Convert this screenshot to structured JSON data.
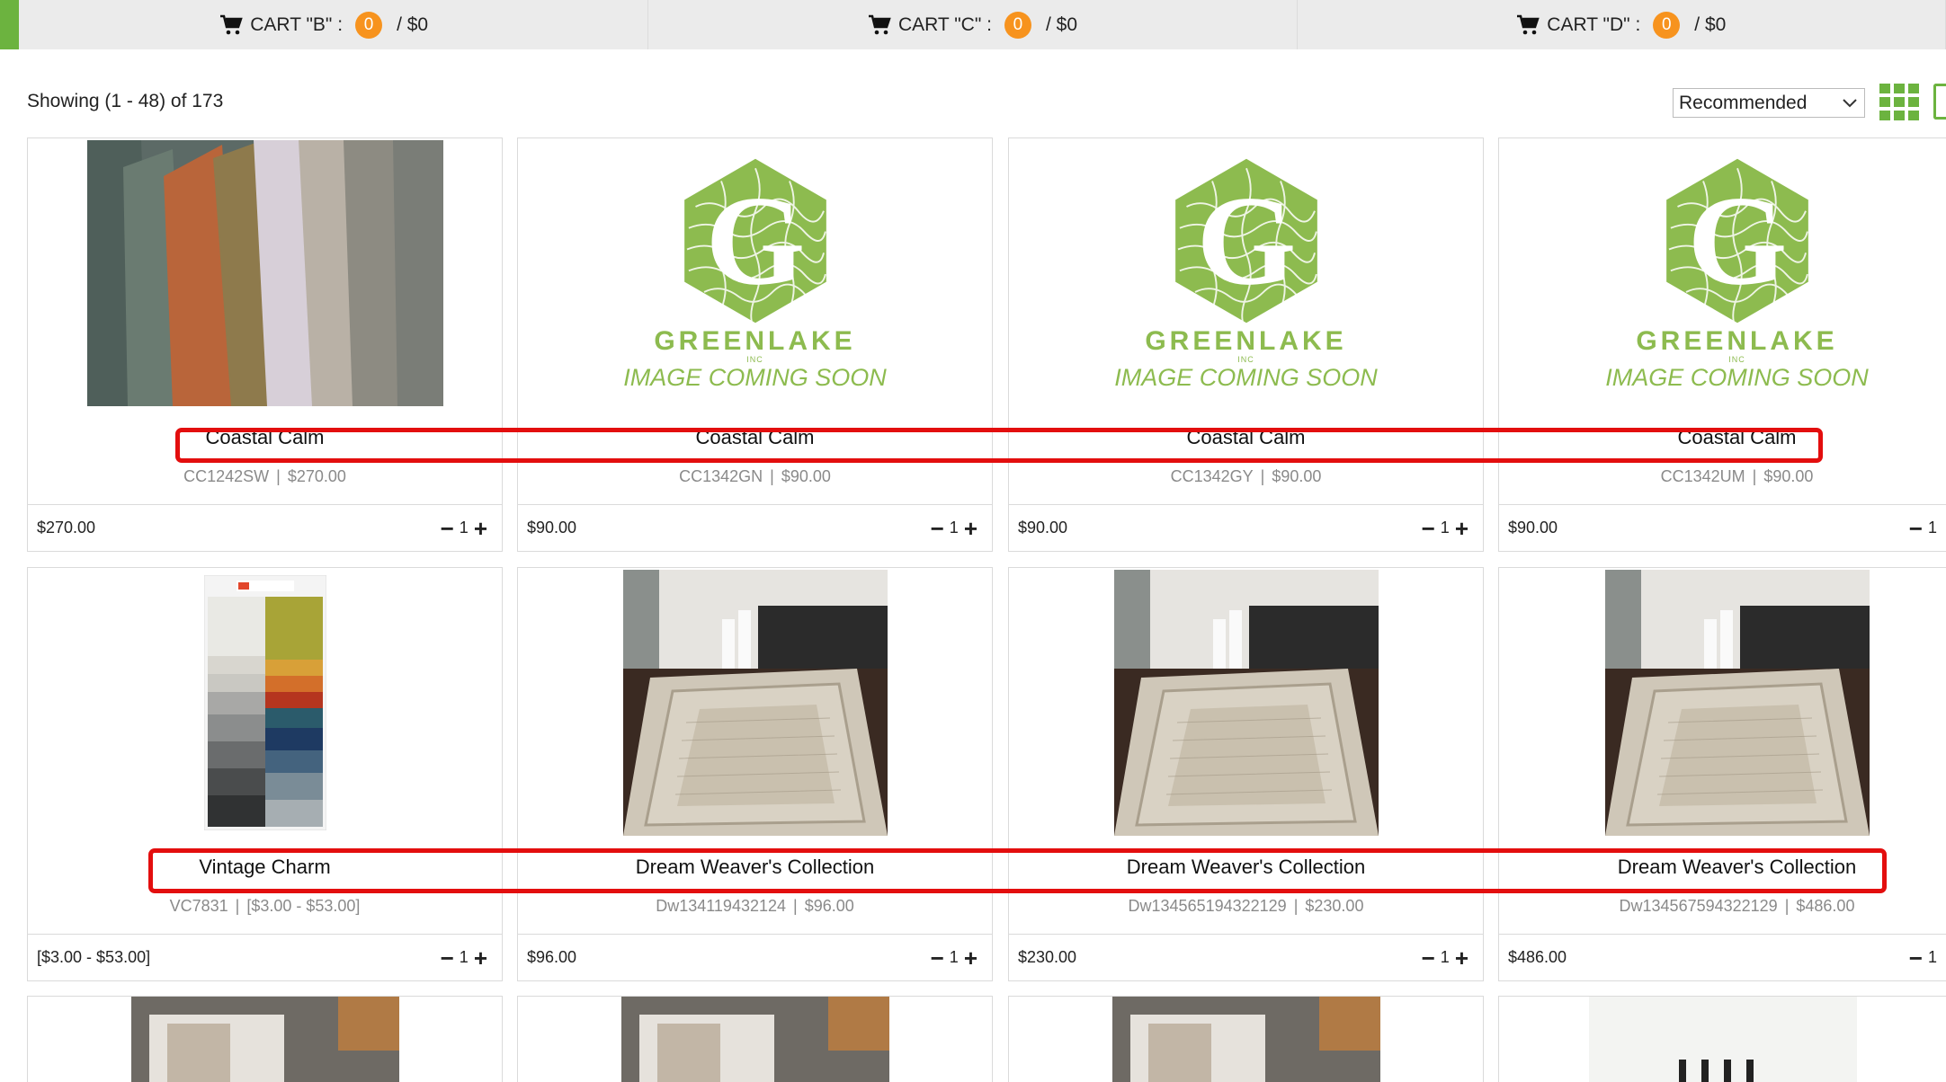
{
  "carts": [
    {
      "label": "CART \"B\" :",
      "count": "0",
      "total": "/ $0"
    },
    {
      "label": "CART \"C\" :",
      "count": "0",
      "total": "/ $0"
    },
    {
      "label": "CART \"D\" :",
      "count": "0",
      "total": "/ $0"
    }
  ],
  "toolbar": {
    "showing": "Showing (1 - 48) of 173",
    "sort_selected": "Recommended"
  },
  "colors": {
    "accent": "#6cb33f",
    "badge": "#f7931e",
    "highlight": "#e30e0e",
    "logo_green": "#8dbb4f"
  },
  "logo": {
    "brand": "GREENLAKE",
    "inc": "INC",
    "placeholder": "IMAGE COMING SOON"
  },
  "products": [
    {
      "name": "Coastal Calm",
      "sku": "CC1242SW",
      "sku_price": "$270.00",
      "price": "$270.00",
      "qty": "1",
      "image": "fabric-swatches"
    },
    {
      "name": "Coastal Calm",
      "sku": "CC1342GN",
      "sku_price": "$90.00",
      "price": "$90.00",
      "qty": "1",
      "image": "greenlake-placeholder"
    },
    {
      "name": "Coastal Calm",
      "sku": "CC1342GY",
      "sku_price": "$90.00",
      "price": "$90.00",
      "qty": "1",
      "image": "greenlake-placeholder"
    },
    {
      "name": "Coastal Calm",
      "sku": "CC1342UM",
      "sku_price": "$90.00",
      "price": "$90.00",
      "qty": "1",
      "image": "greenlake-placeholder"
    },
    {
      "name": "Vintage Charm",
      "sku": "VC7831",
      "sku_price": "[$3.00 - $53.00]",
      "price": "[$3.00 - $53.00]",
      "qty": "1",
      "image": "color-sample-book"
    },
    {
      "name": "Dream Weaver's Collection",
      "sku": "Dw134119432124",
      "sku_price": "$96.00",
      "price": "$96.00",
      "qty": "1",
      "image": "rug-room"
    },
    {
      "name": "Dream Weaver's Collection",
      "sku": "Dw134565194322129",
      "sku_price": "$230.00",
      "price": "$230.00",
      "qty": "1",
      "image": "rug-room"
    },
    {
      "name": "Dream Weaver's Collection",
      "sku": "Dw134567594322129",
      "sku_price": "$486.00",
      "price": "$486.00",
      "qty": "1",
      "image": "rug-room"
    }
  ]
}
